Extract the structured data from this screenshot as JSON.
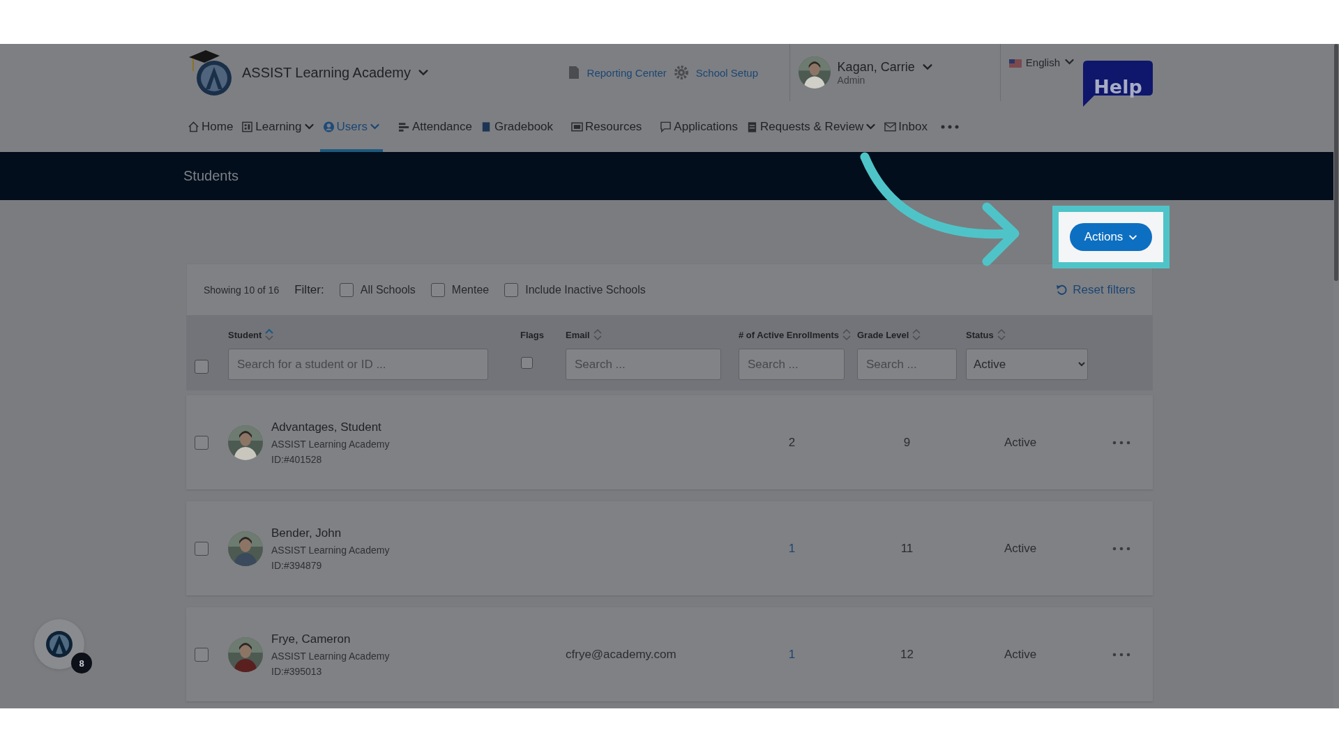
{
  "school": {
    "name": "ASSIST Learning Academy"
  },
  "header_links": [
    {
      "label": "Reporting Center"
    },
    {
      "label": "School Setup"
    }
  ],
  "user": {
    "name": "Kagan, Carrie",
    "role": "Admin"
  },
  "language": "English",
  "help": "Help",
  "nav": [
    {
      "label": "Home",
      "selected": false,
      "dropdown": false
    },
    {
      "label": "Learning",
      "selected": false,
      "dropdown": true
    },
    {
      "label": "Users",
      "selected": true,
      "dropdown": true
    },
    {
      "label": "Attendance",
      "selected": false,
      "dropdown": false
    },
    {
      "label": "Gradebook",
      "selected": false,
      "dropdown": false
    },
    {
      "label": "Resources",
      "selected": false,
      "dropdown": false
    },
    {
      "label": "Applications",
      "selected": false,
      "dropdown": false
    },
    {
      "label": "Requests & Review",
      "selected": false,
      "dropdown": true
    },
    {
      "label": "Inbox",
      "selected": false,
      "dropdown": false
    }
  ],
  "page_title": "Students",
  "actions_button": {
    "label": "Actions",
    "highlighted": true
  },
  "filter": {
    "showing": "Showing 10 of 16",
    "label": "Filter:",
    "options": [
      {
        "label": "All Schools",
        "checked": false
      },
      {
        "label": "Mentee",
        "checked": false
      },
      {
        "label": "Include Inactive Schools",
        "checked": false
      }
    ],
    "reset": "Reset filters"
  },
  "table": {
    "select_all_checked": false,
    "columns": [
      {
        "label": "Student",
        "sortable": true,
        "sorted": true,
        "filter": {
          "kind": "text",
          "placeholder": "Search for a student or ID ..."
        }
      },
      {
        "label": "Flags",
        "sortable": false,
        "filter": {
          "kind": "checkbox",
          "checked": false
        }
      },
      {
        "label": "Email",
        "sortable": true,
        "sorted": false,
        "filter": {
          "kind": "text",
          "placeholder": "Search ..."
        }
      },
      {
        "label": "# of Active Enrollments",
        "sortable": true,
        "sorted": false,
        "filter": {
          "kind": "text",
          "placeholder": "Search ..."
        }
      },
      {
        "label": "Grade Level",
        "sortable": true,
        "sorted": false,
        "filter": {
          "kind": "text",
          "placeholder": "Search ..."
        }
      },
      {
        "label": "Status",
        "sortable": true,
        "sorted": false,
        "filter": {
          "kind": "select",
          "value": "Active"
        }
      }
    ],
    "rows": [
      {
        "checked": false,
        "name": "Advantages, Student",
        "school": "ASSIST Learning Academy",
        "id": "ID:#401528",
        "enrollments": "2",
        "enrollments_link": false,
        "grade": "9",
        "status": "Active"
      },
      {
        "checked": false,
        "name": "Bender, John",
        "school": "ASSIST Learning Academy",
        "id": "ID:#394879",
        "enrollments": "1",
        "enrollments_link": true,
        "grade": "11",
        "status": "Active"
      },
      {
        "checked": false,
        "name": "Frye, Cameron",
        "school": "ASSIST Learning Academy",
        "id": "ID:#395013",
        "email": "cfrye@academy.com",
        "enrollments": "1",
        "enrollments_link": true,
        "grade": "12",
        "status": "Active"
      }
    ]
  },
  "notifications": {
    "count": "8"
  }
}
